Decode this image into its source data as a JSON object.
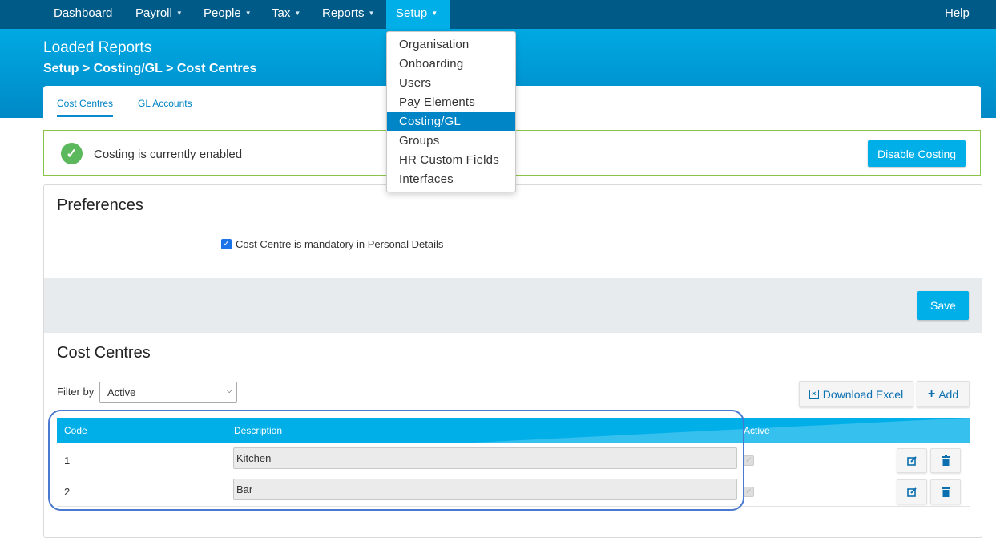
{
  "nav": {
    "items": [
      {
        "label": "Dashboard"
      },
      {
        "label": "Payroll"
      },
      {
        "label": "People"
      },
      {
        "label": "Tax"
      },
      {
        "label": "Reports"
      },
      {
        "label": "Setup"
      }
    ],
    "help": "Help"
  },
  "header": {
    "title": "Loaded Reports",
    "breadcrumb": "Setup > Costing/GL > Cost Centres"
  },
  "tabs": [
    {
      "label": "Cost Centres",
      "active": true
    },
    {
      "label": "GL Accounts",
      "active": false
    }
  ],
  "alert": {
    "text": "Costing is currently enabled",
    "button": "Disable Costing"
  },
  "preferences": {
    "heading": "Preferences",
    "checkbox_label": "Cost Centre is mandatory in Personal Details",
    "checked": true,
    "save": "Save"
  },
  "cost_centres": {
    "heading": "Cost Centres",
    "filter_label": "Filter by",
    "filter_value": "Active",
    "download": "Download Excel",
    "add": "Add",
    "columns": [
      "Code",
      "Description",
      "Active"
    ],
    "rows": [
      {
        "code": "1",
        "description": "Kitchen",
        "active": true
      },
      {
        "code": "2",
        "description": "Bar",
        "active": true
      }
    ]
  },
  "setup_menu": {
    "items": [
      "Organisation",
      "Onboarding",
      "Users",
      "Pay Elements",
      "Costing/GL",
      "Groups",
      "HR Custom Fields",
      "Interfaces"
    ],
    "selected": "Costing/GL"
  },
  "colors": {
    "nav": "#005a87",
    "accent": "#00aee8",
    "link": "#0082c3",
    "success": "#5cb85c"
  }
}
